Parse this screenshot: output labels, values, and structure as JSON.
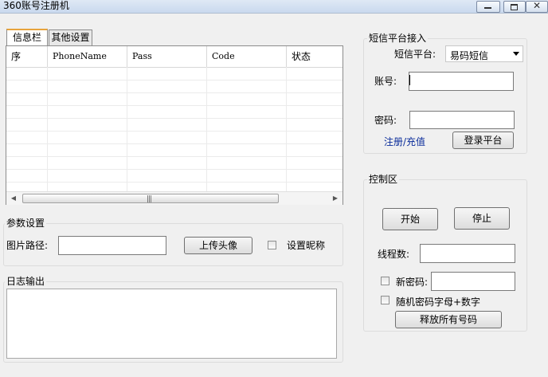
{
  "window": {
    "title": "360账号注册机"
  },
  "tabs": [
    {
      "label": "信息栏"
    },
    {
      "label": "其他设置"
    }
  ],
  "grid": {
    "columns": [
      "序",
      "PhoneName",
      "Pass",
      "Code",
      "状态"
    ],
    "rows": []
  },
  "sms": {
    "group_label": "短信平台接入",
    "platform_label": "短信平台:",
    "platform_value": "易码短信",
    "account_label": "账号:",
    "account_value": "",
    "password_label": "密码:",
    "password_value": "",
    "register_link": "注册/充值",
    "login_button": "登录平台"
  },
  "params": {
    "group_label": "参数设置",
    "image_path_label": "图片路径:",
    "image_path_value": "",
    "upload_button": "上传头像",
    "nickname_checkbox": "设置昵称"
  },
  "log": {
    "group_label": "日志输出",
    "content": ""
  },
  "control": {
    "group_label": "控制区",
    "start_button": "开始",
    "stop_button": "停止",
    "threads_label": "线程数:",
    "threads_value": "",
    "new_password_label": "新密码:",
    "new_password_value": "",
    "random_password_label": "随机密码字母+数字",
    "release_button": "释放所有号码"
  }
}
